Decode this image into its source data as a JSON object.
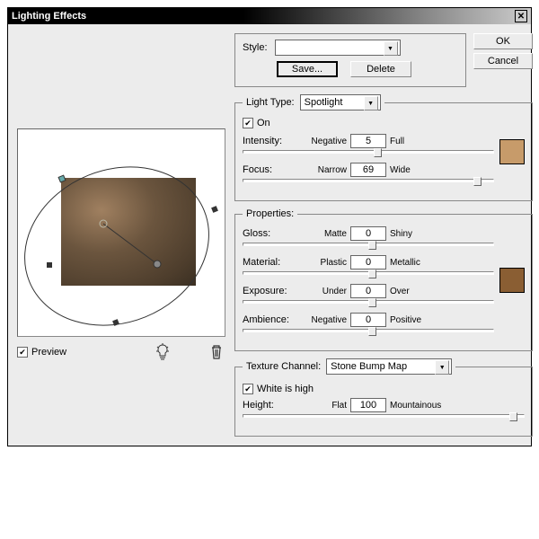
{
  "title": "Lighting Effects",
  "buttons": {
    "ok": "OK",
    "cancel": "Cancel",
    "save": "Save...",
    "delete": "Delete"
  },
  "preview_label": "Preview",
  "style": {
    "label": "Style:",
    "value": ""
  },
  "lightType": {
    "legend": "Light Type:",
    "value": "Spotlight",
    "on_label": "On",
    "intensity": {
      "label": "Intensity:",
      "left": "Negative",
      "right": "Full",
      "value": "5",
      "pos": 52
    },
    "focus": {
      "label": "Focus:",
      "left": "Narrow",
      "right": "Wide",
      "value": "69",
      "pos": 92
    },
    "color": "#c79b6a"
  },
  "properties": {
    "legend": "Properties:",
    "gloss": {
      "label": "Gloss:",
      "left": "Matte",
      "right": "Shiny",
      "value": "0",
      "pos": 50
    },
    "material": {
      "label": "Material:",
      "left": "Plastic",
      "right": "Metallic",
      "value": "0",
      "pos": 50
    },
    "exposure": {
      "label": "Exposure:",
      "left": "Under",
      "right": "Over",
      "value": "0",
      "pos": 50
    },
    "ambience": {
      "label": "Ambience:",
      "left": "Negative",
      "right": "Positive",
      "value": "0",
      "pos": 50
    },
    "color": "#8a5e33"
  },
  "texture": {
    "legend": "Texture Channel:",
    "value": "Stone Bump Map",
    "white_label": "White is high",
    "height": {
      "label": "Height:",
      "left": "Flat",
      "right": "Mountainous",
      "value": "100",
      "pos": 95
    }
  }
}
